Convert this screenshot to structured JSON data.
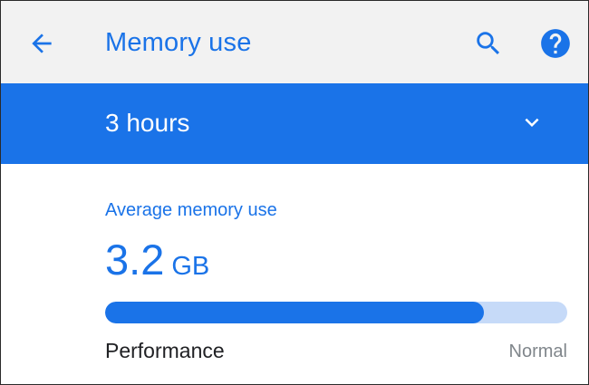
{
  "header": {
    "title": "Memory use",
    "back_icon": "arrow-left-icon",
    "search_icon": "search-icon",
    "help_icon": "help-circle-icon"
  },
  "time_range": {
    "selected": "3 hours",
    "dropdown_icon": "chevron-down-icon"
  },
  "summary": {
    "label": "Average memory use",
    "value": "3.2",
    "unit": "GB",
    "usage_fraction": 0.82
  },
  "performance": {
    "label": "Performance",
    "status": "Normal"
  },
  "colors": {
    "accent": "#1a73e8",
    "track": "#c6daf8",
    "header_bg": "#f2f2f2",
    "status_text": "#80868b"
  }
}
